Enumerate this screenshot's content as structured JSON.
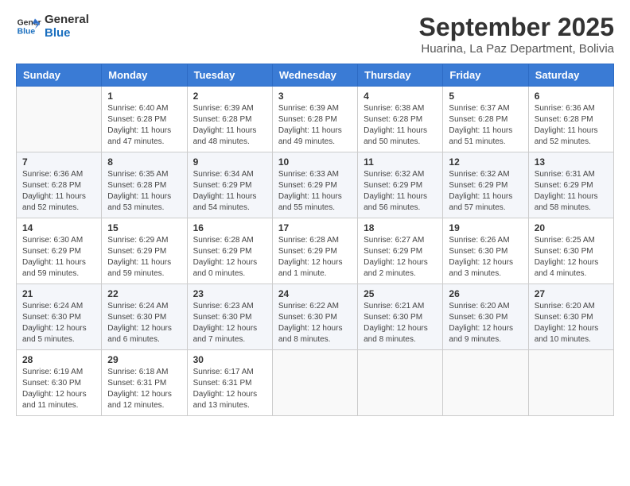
{
  "logo": {
    "line1": "General",
    "line2": "Blue"
  },
  "title": "September 2025",
  "subtitle": "Huarina, La Paz Department, Bolivia",
  "days_header": [
    "Sunday",
    "Monday",
    "Tuesday",
    "Wednesday",
    "Thursday",
    "Friday",
    "Saturday"
  ],
  "weeks": [
    [
      {
        "day": "",
        "info": ""
      },
      {
        "day": "1",
        "info": "Sunrise: 6:40 AM\nSunset: 6:28 PM\nDaylight: 11 hours\nand 47 minutes."
      },
      {
        "day": "2",
        "info": "Sunrise: 6:39 AM\nSunset: 6:28 PM\nDaylight: 11 hours\nand 48 minutes."
      },
      {
        "day": "3",
        "info": "Sunrise: 6:39 AM\nSunset: 6:28 PM\nDaylight: 11 hours\nand 49 minutes."
      },
      {
        "day": "4",
        "info": "Sunrise: 6:38 AM\nSunset: 6:28 PM\nDaylight: 11 hours\nand 50 minutes."
      },
      {
        "day": "5",
        "info": "Sunrise: 6:37 AM\nSunset: 6:28 PM\nDaylight: 11 hours\nand 51 minutes."
      },
      {
        "day": "6",
        "info": "Sunrise: 6:36 AM\nSunset: 6:28 PM\nDaylight: 11 hours\nand 52 minutes."
      }
    ],
    [
      {
        "day": "7",
        "info": "Sunrise: 6:36 AM\nSunset: 6:28 PM\nDaylight: 11 hours\nand 52 minutes."
      },
      {
        "day": "8",
        "info": "Sunrise: 6:35 AM\nSunset: 6:28 PM\nDaylight: 11 hours\nand 53 minutes."
      },
      {
        "day": "9",
        "info": "Sunrise: 6:34 AM\nSunset: 6:29 PM\nDaylight: 11 hours\nand 54 minutes."
      },
      {
        "day": "10",
        "info": "Sunrise: 6:33 AM\nSunset: 6:29 PM\nDaylight: 11 hours\nand 55 minutes."
      },
      {
        "day": "11",
        "info": "Sunrise: 6:32 AM\nSunset: 6:29 PM\nDaylight: 11 hours\nand 56 minutes."
      },
      {
        "day": "12",
        "info": "Sunrise: 6:32 AM\nSunset: 6:29 PM\nDaylight: 11 hours\nand 57 minutes."
      },
      {
        "day": "13",
        "info": "Sunrise: 6:31 AM\nSunset: 6:29 PM\nDaylight: 11 hours\nand 58 minutes."
      }
    ],
    [
      {
        "day": "14",
        "info": "Sunrise: 6:30 AM\nSunset: 6:29 PM\nDaylight: 11 hours\nand 59 minutes."
      },
      {
        "day": "15",
        "info": "Sunrise: 6:29 AM\nSunset: 6:29 PM\nDaylight: 11 hours\nand 59 minutes."
      },
      {
        "day": "16",
        "info": "Sunrise: 6:28 AM\nSunset: 6:29 PM\nDaylight: 12 hours\nand 0 minutes."
      },
      {
        "day": "17",
        "info": "Sunrise: 6:28 AM\nSunset: 6:29 PM\nDaylight: 12 hours\nand 1 minute."
      },
      {
        "day": "18",
        "info": "Sunrise: 6:27 AM\nSunset: 6:29 PM\nDaylight: 12 hours\nand 2 minutes."
      },
      {
        "day": "19",
        "info": "Sunrise: 6:26 AM\nSunset: 6:30 PM\nDaylight: 12 hours\nand 3 minutes."
      },
      {
        "day": "20",
        "info": "Sunrise: 6:25 AM\nSunset: 6:30 PM\nDaylight: 12 hours\nand 4 minutes."
      }
    ],
    [
      {
        "day": "21",
        "info": "Sunrise: 6:24 AM\nSunset: 6:30 PM\nDaylight: 12 hours\nand 5 minutes."
      },
      {
        "day": "22",
        "info": "Sunrise: 6:24 AM\nSunset: 6:30 PM\nDaylight: 12 hours\nand 6 minutes."
      },
      {
        "day": "23",
        "info": "Sunrise: 6:23 AM\nSunset: 6:30 PM\nDaylight: 12 hours\nand 7 minutes."
      },
      {
        "day": "24",
        "info": "Sunrise: 6:22 AM\nSunset: 6:30 PM\nDaylight: 12 hours\nand 8 minutes."
      },
      {
        "day": "25",
        "info": "Sunrise: 6:21 AM\nSunset: 6:30 PM\nDaylight: 12 hours\nand 8 minutes."
      },
      {
        "day": "26",
        "info": "Sunrise: 6:20 AM\nSunset: 6:30 PM\nDaylight: 12 hours\nand 9 minutes."
      },
      {
        "day": "27",
        "info": "Sunrise: 6:20 AM\nSunset: 6:30 PM\nDaylight: 12 hours\nand 10 minutes."
      }
    ],
    [
      {
        "day": "28",
        "info": "Sunrise: 6:19 AM\nSunset: 6:30 PM\nDaylight: 12 hours\nand 11 minutes."
      },
      {
        "day": "29",
        "info": "Sunrise: 6:18 AM\nSunset: 6:31 PM\nDaylight: 12 hours\nand 12 minutes."
      },
      {
        "day": "30",
        "info": "Sunrise: 6:17 AM\nSunset: 6:31 PM\nDaylight: 12 hours\nand 13 minutes."
      },
      {
        "day": "",
        "info": ""
      },
      {
        "day": "",
        "info": ""
      },
      {
        "day": "",
        "info": ""
      },
      {
        "day": "",
        "info": ""
      }
    ]
  ]
}
